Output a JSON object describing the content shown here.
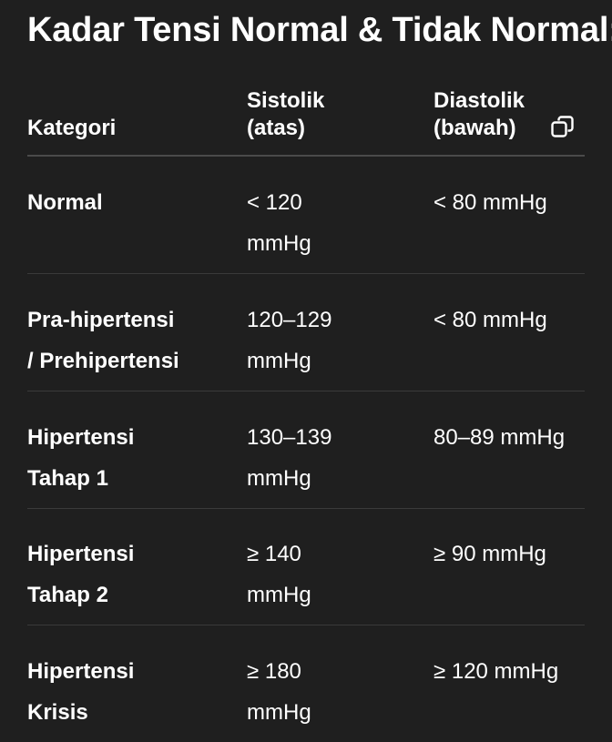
{
  "title": "Kadar Tensi Normal & Tidak Normal:",
  "table": {
    "headers": {
      "kategori": "Kategori",
      "sistolik_line1": "Sistolik",
      "sistolik_line2": "(atas)",
      "diastolik_line1": "Diastolik",
      "diastolik_line2": "(bawah)"
    },
    "copy_icon": "copy-icon",
    "rows": [
      {
        "kategori": [
          "Normal"
        ],
        "sistolik": [
          "< 120",
          "mmHg"
        ],
        "diastolik": [
          "< 80 mmHg"
        ]
      },
      {
        "kategori": [
          "Pra-hipertensi",
          "/ Prehipertensi"
        ],
        "sistolik": [
          "120–129",
          "mmHg"
        ],
        "diastolik": [
          "< 80 mmHg"
        ]
      },
      {
        "kategori": [
          "Hipertensi",
          "Tahap 1"
        ],
        "sistolik": [
          "130–139",
          "mmHg"
        ],
        "diastolik": [
          "80–89 mmHg"
        ]
      },
      {
        "kategori": [
          "Hipertensi",
          "Tahap 2"
        ],
        "sistolik": [
          "≥ 140",
          "mmHg"
        ],
        "diastolik": [
          "≥ 90 mmHg"
        ]
      },
      {
        "kategori": [
          "Hipertensi",
          "Krisis"
        ],
        "sistolik": [
          "≥ 180",
          "mmHg"
        ],
        "diastolik": [
          "≥ 120 mmHg"
        ]
      }
    ]
  },
  "colors": {
    "background": "#1f1f1f",
    "text": "#ffffff",
    "divider": "#3a3a3a"
  }
}
